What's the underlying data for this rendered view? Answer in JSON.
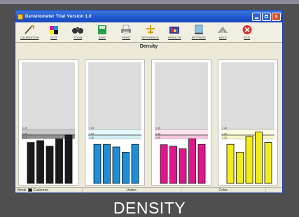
{
  "window": {
    "title": "Densitometer Trial Version 1.0"
  },
  "toolbar": [
    {
      "label": "Calibration",
      "icon": "calibrate-icon"
    },
    {
      "label": "Edit",
      "icon": "edit-icon"
    },
    {
      "label": "Zoom",
      "icon": "zoom-icon"
    },
    {
      "label": "Save",
      "icon": "save-icon"
    },
    {
      "label": "Print",
      "icon": "print-icon"
    },
    {
      "label": "Reference",
      "icon": "reference-icon"
    },
    {
      "label": "Results",
      "icon": "results-icon"
    },
    {
      "label": "Settings",
      "icon": "settings-icon"
    },
    {
      "label": "Help",
      "icon": "help-icon"
    },
    {
      "label": "Exit",
      "icon": "exit-icon"
    }
  ],
  "heading": "Density",
  "chart_data": [
    {
      "type": "bar",
      "name": "Black",
      "color": "#1a1a1a",
      "band_color": "#8f8f8f",
      "band_tint": "#c8c8c8",
      "ylim": [
        0.0,
        3.2
      ],
      "band": [
        1.2,
        1.45
      ],
      "ticks": [
        1.45,
        1.3,
        1.2
      ],
      "values": [
        1.1,
        1.15,
        1.0,
        1.2,
        1.3
      ]
    },
    {
      "type": "bar",
      "name": "Cyan",
      "color": "#1e8fd6",
      "band_color": "#cfeff4",
      "band_tint": "#e4f7fa",
      "ylim": [
        0.0,
        3.2
      ],
      "band": [
        1.2,
        1.45
      ],
      "ticks": [
        1.45,
        1.3,
        1.2
      ],
      "values": [
        1.05,
        1.05,
        0.98,
        0.84,
        1.05
      ]
    },
    {
      "type": "bar",
      "name": "Magenta",
      "color": "#e0178c",
      "band_color": "#f6c4e0",
      "band_tint": "#fbe2ef",
      "ylim": [
        0.0,
        3.2
      ],
      "band": [
        1.2,
        1.45
      ],
      "ticks": [
        1.45,
        1.3,
        1.2
      ],
      "values": [
        1.04,
        1.0,
        0.93,
        1.2,
        1.05
      ]
    },
    {
      "type": "bar",
      "name": "Yellow",
      "color": "#f3ec17",
      "band_color": "#fbf6c4",
      "band_tint": "#fdfbe2",
      "ylim": [
        0.0,
        3.2
      ],
      "band": [
        1.2,
        1.45
      ],
      "ticks": [
        1.45,
        1.3,
        1.2
      ],
      "values": [
        1.05,
        0.84,
        1.26,
        1.38,
        1.1
      ]
    }
  ],
  "status": {
    "mode_label": "Mode",
    "mode_value": "Customer",
    "unit_label": "Under:",
    "color_label": "Color:"
  },
  "caption": "DENSITY"
}
